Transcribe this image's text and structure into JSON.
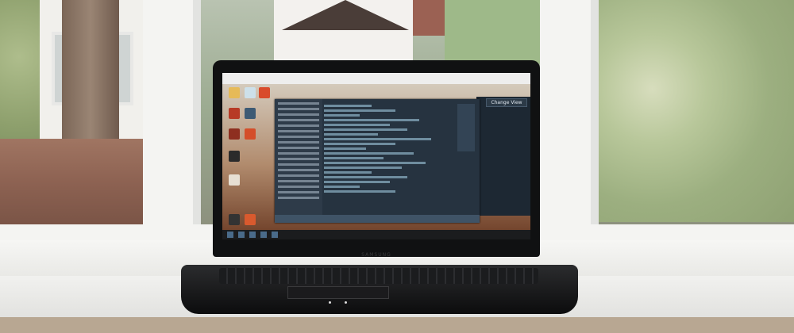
{
  "photo": {
    "subject": "laptop on windowsill",
    "laptop_brand": "SAMSUNG",
    "screen": {
      "button_label": "Change View"
    }
  },
  "colors": {
    "frame": "#f4f4f2",
    "laptop_body": "#101112",
    "editor_bg": "#263340",
    "foliage": "#b8c79a"
  }
}
